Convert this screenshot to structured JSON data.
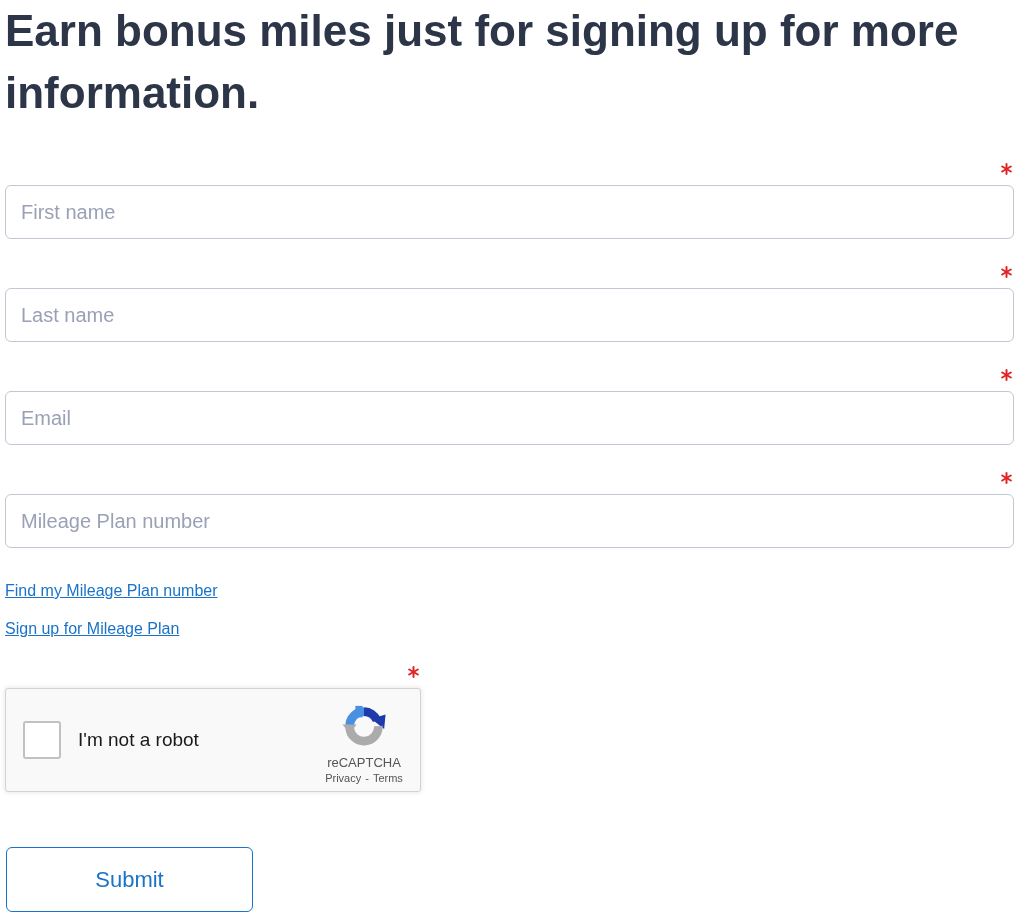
{
  "heading": "Earn bonus miles just for signing up for more information.",
  "fields": [
    {
      "placeholder": "First name",
      "required": true
    },
    {
      "placeholder": "Last name",
      "required": true
    },
    {
      "placeholder": "Email",
      "required": true
    },
    {
      "placeholder": "Mileage Plan number",
      "required": true
    }
  ],
  "links": [
    "Find my Mileage Plan number",
    "Sign up for Mileage Plan"
  ],
  "captcha": {
    "required": true,
    "checked": false,
    "label": "I'm not a robot",
    "brand": "reCAPTCHA",
    "privacy": "Privacy",
    "separator": "-",
    "terms": "Terms"
  },
  "submit": "Submit"
}
